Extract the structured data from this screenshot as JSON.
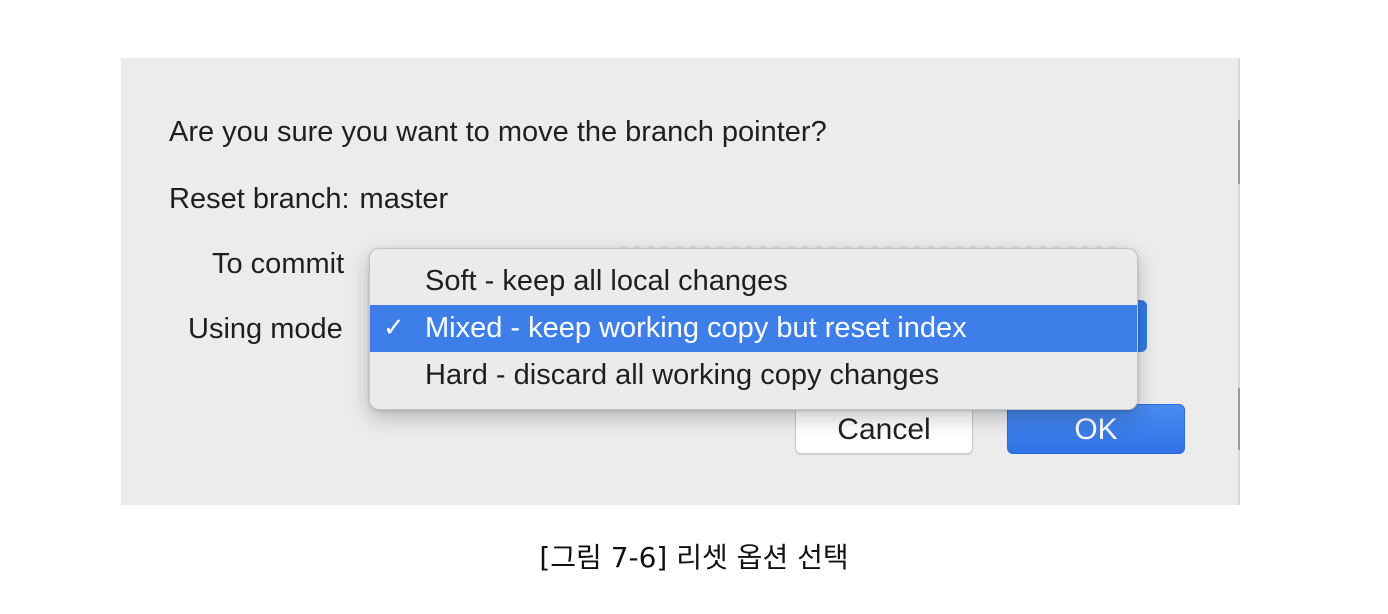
{
  "dialog": {
    "question": "Are you sure you want to move the branch pointer?",
    "reset_branch_label": "Reset branch:",
    "reset_branch_value": "master",
    "to_commit_label": "To commit",
    "using_mode_label": "Using mode"
  },
  "mode_menu": {
    "selected_index": 1,
    "items": [
      {
        "label": "Soft - keep all local changes",
        "checked": false
      },
      {
        "label": "Mixed - keep working copy but reset index",
        "checked": true
      },
      {
        "label": "Hard - discard all working copy changes",
        "checked": false
      }
    ],
    "check_glyph": "✓"
  },
  "buttons": {
    "cancel_label": "Cancel",
    "ok_label": "OK"
  },
  "caption": "[그림 7-6] 리셋 옵션 선택",
  "colors": {
    "dialog_background": "#ececec",
    "accent_blue": "#3d7ee9",
    "menu_background": "#ebebeb"
  }
}
